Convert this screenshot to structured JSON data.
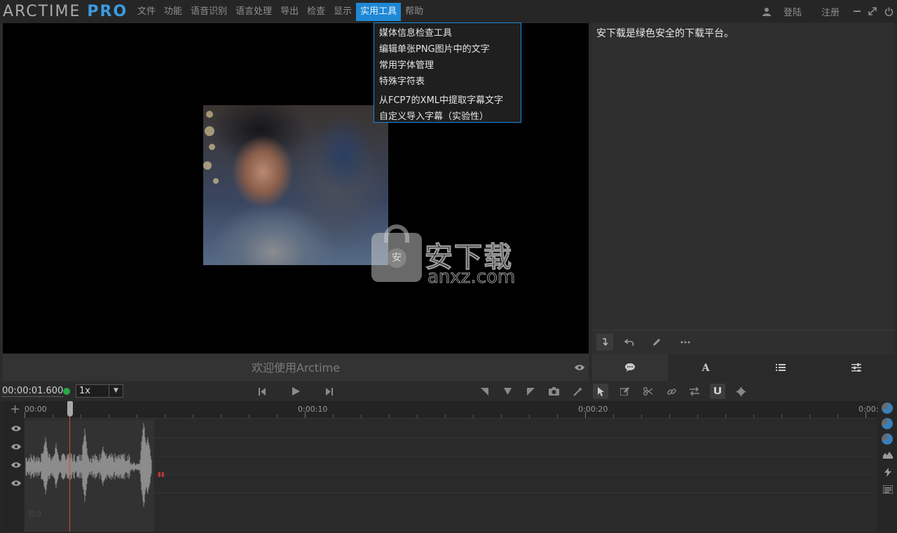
{
  "app": {
    "logo_main": "ARCTIME",
    "logo_pro": "PRO"
  },
  "menu": {
    "items": [
      "文件",
      "功能",
      "语音识别",
      "语言处理",
      "导出",
      "检查",
      "显示",
      "实用工具",
      "帮助"
    ],
    "active": "实用工具",
    "login": "登陆",
    "register": "注册"
  },
  "dropdown": {
    "items": [
      "媒体信息检查工具",
      "编辑单张PNG图片中的文字",
      "常用字体管理",
      "特殊字符表",
      "从FCP7的XML中提取字幕文字",
      "自定义导入字幕（实验性）"
    ]
  },
  "watermark": {
    "cn": "安下载",
    "en": "anxz.com",
    "badge": "安"
  },
  "video": {
    "welcome": "欢迎使用Arctime"
  },
  "text_panel": {
    "content": "安下载是绿色安全的下载平台。"
  },
  "transport": {
    "timecode": "00:00:01.600",
    "speed": "1x"
  },
  "timeline": {
    "ruler_labels": [
      "00:00",
      "0:00:10",
      "0:00:20",
      "0:00:"
    ],
    "track_label": "忘:0",
    "playhead_time_s": 1.6
  },
  "colors": {
    "accent": "#1e88d6",
    "playhead": "#e0462a",
    "status_dot": "#28a745",
    "background": "#2b2b2b"
  },
  "icons": {
    "user": "user-icon",
    "minimize": "minimize-icon",
    "maximize": "maximize-icon",
    "power": "power-icon",
    "eye": "eye-icon"
  }
}
